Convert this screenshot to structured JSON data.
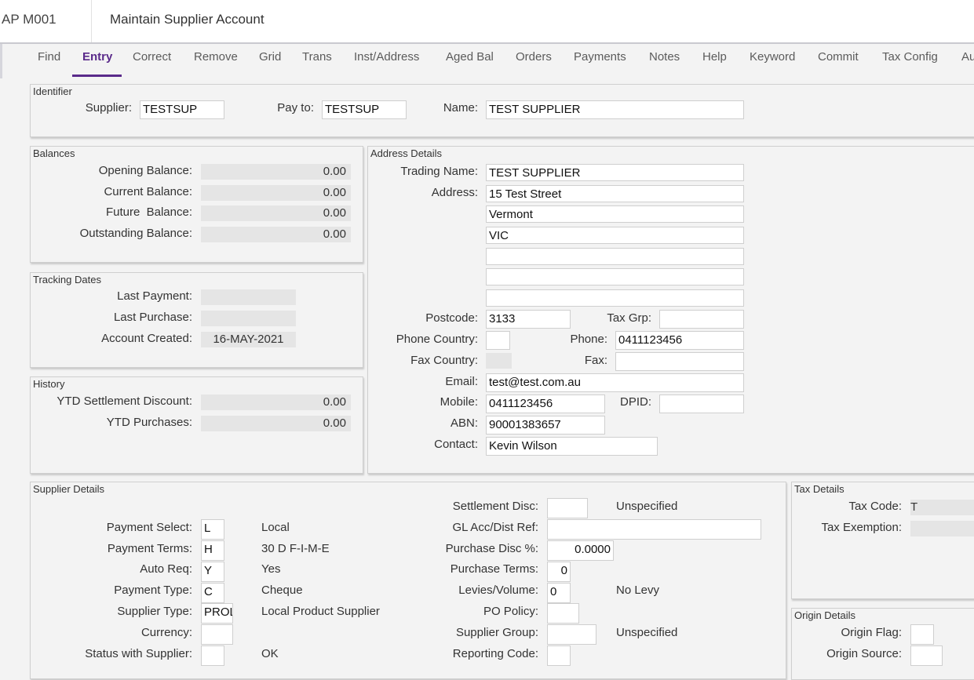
{
  "header": {
    "program_code": "AP M001",
    "title": "Maintain Supplier Account"
  },
  "menu": [
    {
      "label": "Find"
    },
    {
      "label": "Entry"
    },
    {
      "label": "Correct"
    },
    {
      "label": "Remove"
    },
    {
      "label": "Grid"
    },
    {
      "label": "Trans"
    },
    {
      "label": "Inst/Address"
    },
    {
      "label": "Aged Bal"
    },
    {
      "label": "Orders"
    },
    {
      "label": "Payments"
    },
    {
      "label": "Notes"
    },
    {
      "label": "Help"
    },
    {
      "label": "Keyword"
    },
    {
      "label": "Commit"
    },
    {
      "label": "Tax Config"
    },
    {
      "label": "Au"
    }
  ],
  "active_menu": "Entry",
  "accent_color": "#5a2a8a",
  "identifier": {
    "title": "Identifier",
    "supplier_label": "Supplier:",
    "supplier_value": "TESTSUP",
    "payto_label": "Pay to:",
    "payto_value": "TESTSUP",
    "name_label": "Name:",
    "name_value": "TEST SUPPLIER"
  },
  "balances": {
    "title": "Balances",
    "opening_label": "Opening Balance:",
    "opening_value": "0.00",
    "current_label": "Current Balance:",
    "current_value": "0.00",
    "future_label": "Future  Balance:",
    "future_value": "0.00",
    "outstanding_label": "Outstanding Balance:",
    "outstanding_value": "0.00"
  },
  "tracking": {
    "title": "Tracking Dates",
    "last_payment_label": "Last Payment:",
    "last_payment_value": "",
    "last_purchase_label": "Last Purchase:",
    "last_purchase_value": "",
    "created_label": "Account Created:",
    "created_value": "16-MAY-2021"
  },
  "history": {
    "title": "History",
    "ytd_disc_label": "YTD Settlement Discount:",
    "ytd_disc_value": "0.00",
    "ytd_purch_label": "YTD Purchases:",
    "ytd_purch_value": "0.00"
  },
  "address": {
    "title": "Address Details",
    "trading_label": "Trading Name:",
    "trading_value": "TEST SUPPLIER",
    "address_label": "Address:",
    "line1": "15 Test Street",
    "line2": "Vermont",
    "line3": "VIC",
    "line4": "",
    "line5": "",
    "line6": "",
    "postcode_label": "Postcode:",
    "postcode_value": "3133",
    "taxgrp_label": "Tax Grp:",
    "taxgrp_value": "",
    "phone_country_label": "Phone Country:",
    "phone_country_value": "",
    "phone_label": "Phone:",
    "phone_value": "0411123456",
    "fax_country_label": "Fax Country:",
    "fax_country_value": "",
    "fax_label": "Fax:",
    "fax_value": "",
    "email_label": "Email:",
    "email_value": "test@test.com.au",
    "mobile_label": "Mobile:",
    "mobile_value": "0411123456",
    "dpid_label": "DPID:",
    "dpid_value": "",
    "abn_label": "ABN:",
    "abn_value": "90001383657",
    "contact_label": "Contact:",
    "contact_value": "Kevin Wilson"
  },
  "supplier_details": {
    "title": "Supplier Details",
    "payment_select_label": "Payment Select:",
    "payment_select_code": "L",
    "payment_select_desc": "Local",
    "payment_terms_label": "Payment Terms:",
    "payment_terms_code": "H",
    "payment_terms_desc": "30 D F-I-M-E",
    "auto_req_label": "Auto Req:",
    "auto_req_code": "Y",
    "auto_req_desc": "Yes",
    "payment_type_label": "Payment Type:",
    "payment_type_code": "C",
    "payment_type_desc": "Cheque",
    "supplier_type_label": "Supplier Type:",
    "supplier_type_code": "PROL",
    "supplier_type_desc": "Local Product Supplier",
    "currency_label": "Currency:",
    "currency_code": "",
    "status_label": "Status with Supplier:",
    "status_code": "",
    "status_desc": "OK",
    "settlement_label": "Settlement Disc:",
    "settlement_value": "",
    "settlement_desc": "Unspecified",
    "glacc_label": "GL Acc/Dist Ref:",
    "glacc_value": "",
    "purch_disc_label": "Purchase Disc %:",
    "purch_disc_value": "0.0000",
    "purch_terms_label": "Purchase Terms:",
    "purch_terms_value": "0",
    "levies_label": "Levies/Volume:",
    "levies_value": "0",
    "levies_desc": "No Levy",
    "po_policy_label": "PO Policy:",
    "po_policy_value": "",
    "supplier_group_label": "Supplier Group:",
    "supplier_group_value": "",
    "supplier_group_desc": "Unspecified",
    "reporting_label": "Reporting Code:",
    "reporting_value": ""
  },
  "tax_details": {
    "title": "Tax Details",
    "tax_code_label": "Tax Code:",
    "tax_code_value": "T",
    "exemption_label": "Tax Exemption:",
    "exemption_value": ""
  },
  "origin_details": {
    "title": "Origin Details",
    "flag_label": "Origin Flag:",
    "flag_value": "",
    "source_label": "Origin Source:",
    "source_value": ""
  }
}
